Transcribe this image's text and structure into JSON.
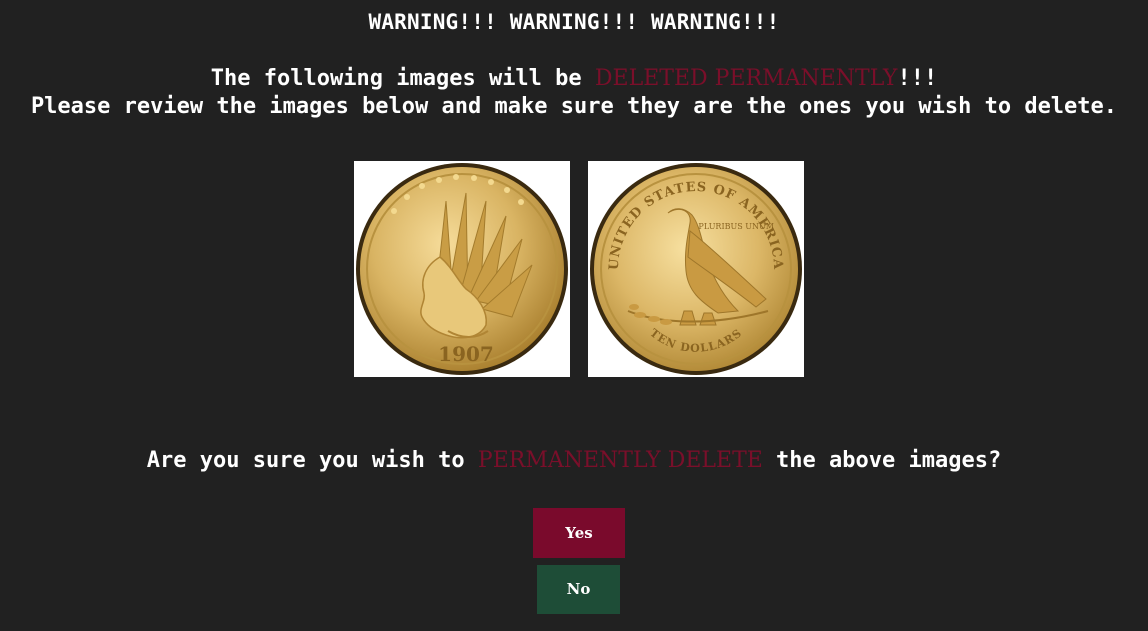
{
  "header": {
    "title": "WARNING!!! WARNING!!! WARNING!!!"
  },
  "intro": {
    "line1_before": "The following images will be ",
    "line1_danger": "DELETED PERMANENTLY",
    "line1_after": "!!!",
    "line2": "Please review the images below and make sure they are the ones you wish to delete."
  },
  "images": {
    "front": {
      "year": "1907"
    },
    "back": {
      "top_legend": "UNITED STATES OF AMERICA",
      "motto": "E PLURIBUS UNUM",
      "denomination": "TEN DOLLARS"
    }
  },
  "confirm": {
    "question_before": "Are you sure you wish to ",
    "question_danger": "PERMANENTLY DELETE",
    "question_after": " the above images?",
    "yes_label": "Yes",
    "no_label": "No"
  },
  "colors": {
    "background": "#212121",
    "danger_text": "#7a0f2a",
    "yes_button": "#7a0a2c",
    "no_button": "#1e4d37",
    "coin_gold": "#d4ab55"
  }
}
